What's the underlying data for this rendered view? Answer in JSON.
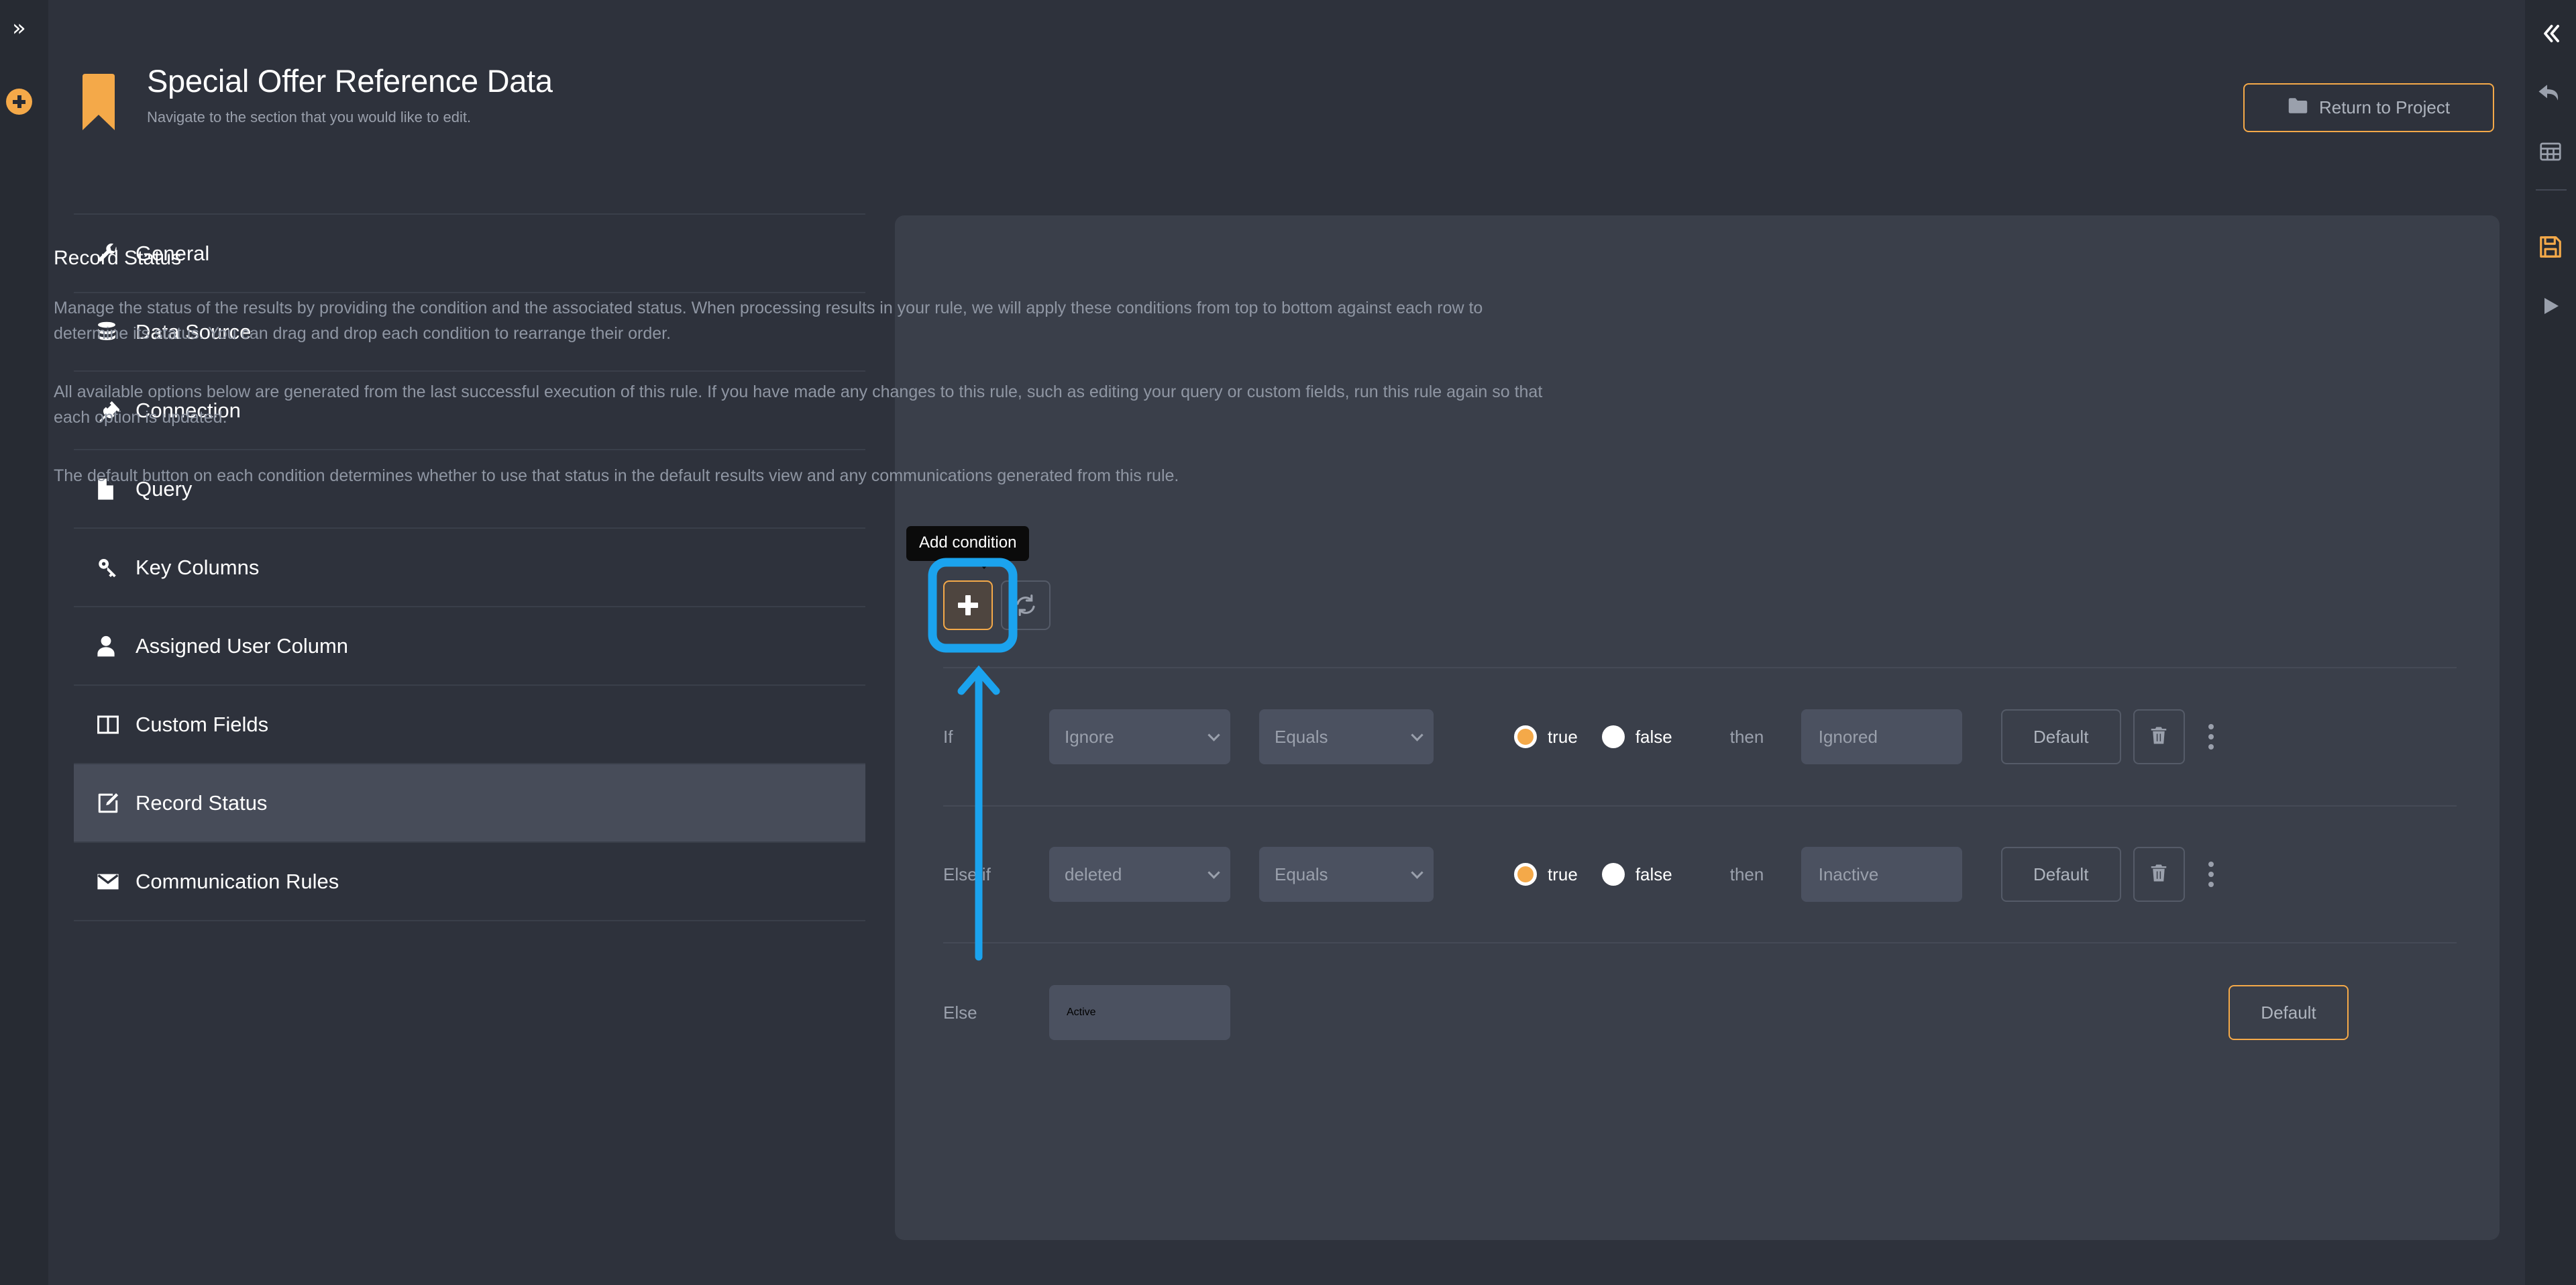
{
  "left_rail": {
    "expand_icon": "chevron-double-right-icon",
    "expand_glyph": "»",
    "add_icon": "plus-circle-icon",
    "accent": "#f4a949"
  },
  "right_rail": {
    "items": [
      {
        "icon": "chevron-double-left-icon",
        "label": "Collapse"
      },
      {
        "icon": "undo-arrow-icon",
        "label": "Undo"
      },
      {
        "icon": "table-grid-icon",
        "label": "Table"
      },
      {
        "icon": "save-floppy-icon",
        "label": "Save",
        "color": "#f4a949"
      },
      {
        "icon": "play-triangle-icon",
        "label": "Run"
      }
    ]
  },
  "header": {
    "icon": "bookmark-icon",
    "icon_color": "#f4a949",
    "title": "Special Offer Reference Data",
    "subtitle": "Navigate to the section that you would like to edit.",
    "return_button": {
      "label": "Return to Project",
      "icon": "folder-icon",
      "border_color": "#f4a949"
    }
  },
  "sidebar": {
    "items": [
      {
        "label": "General",
        "icon": "wrench-icon",
        "active": false
      },
      {
        "label": "Data Source",
        "icon": "database-icon",
        "active": false
      },
      {
        "label": "Connection",
        "icon": "plug-icon",
        "active": false
      },
      {
        "label": "Query",
        "icon": "file-icon",
        "active": false
      },
      {
        "label": "Key Columns",
        "icon": "key-icon",
        "active": false
      },
      {
        "label": "Assigned User Column",
        "icon": "user-icon",
        "active": false
      },
      {
        "label": "Custom Fields",
        "icon": "columns-icon",
        "active": false
      },
      {
        "label": "Record Status",
        "icon": "edit-square-icon",
        "active": true
      },
      {
        "label": "Communication Rules",
        "icon": "envelope-icon",
        "active": false
      }
    ]
  },
  "panel": {
    "title": "Record Status",
    "paragraph_1": "Manage the status of the results by providing the condition and the associated status. When processing results in your rule, we will apply these conditions from top to bottom against each row to determine its status. You can drag and drop each condition to rearrange their order.",
    "paragraph_2": "All available options below are generated from the last successful execution of this rule. If you have made any changes to this rule, such as editing your query or custom fields, run this rule again so that each option is updated.",
    "paragraph_3": "The default button on each condition determines whether to use that status in the default results view and any communications generated from this rule."
  },
  "toolbar": {
    "add_label": "+",
    "add_icon": "plus-icon",
    "refresh_icon": "refresh-icon",
    "tooltip": "Add condition",
    "highlight_color": "#1ba3ee"
  },
  "conditions": {
    "rows": [
      {
        "prefix": "If",
        "field": "Ignore",
        "operator": "Equals",
        "true_label": "true",
        "false_label": "false",
        "selected_bool": "true",
        "then_label": "then",
        "status": "Ignored",
        "default_label": "Default",
        "default_active": false,
        "delete_icon": "trash-icon",
        "menu_icon": "kebab-menu-icon"
      },
      {
        "prefix": "Else if",
        "field": "deleted",
        "operator": "Equals",
        "true_label": "true",
        "false_label": "false",
        "selected_bool": "true",
        "then_label": "then",
        "status": "Inactive",
        "default_label": "Default",
        "default_active": false,
        "delete_icon": "trash-icon",
        "menu_icon": "kebab-menu-icon"
      }
    ],
    "else_row": {
      "prefix": "Else",
      "status": "Active",
      "default_label": "Default",
      "default_active": true
    }
  }
}
